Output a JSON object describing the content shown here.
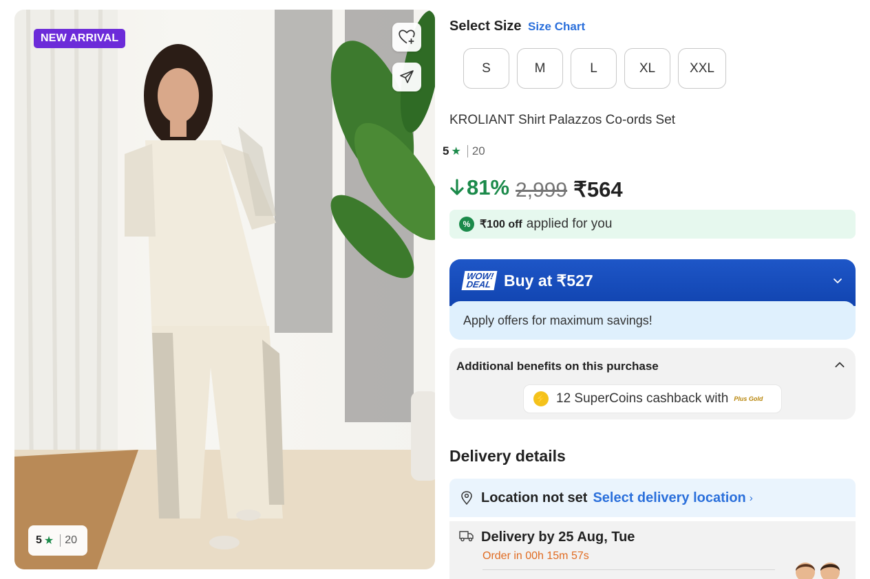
{
  "product": {
    "badge": "NEW ARRIVAL",
    "image_rating": {
      "value": "5",
      "count": "20"
    },
    "title": "KROLIANT Shirt Palazzos Co-ords Set",
    "rating": {
      "value": "5",
      "count": "20"
    }
  },
  "size": {
    "heading": "Select Size",
    "chart_link": "Size Chart",
    "options": [
      "S",
      "M",
      "L",
      "XL",
      "XXL"
    ]
  },
  "price": {
    "discount": "81%",
    "mrp": "2,999",
    "final": "₹564"
  },
  "offer_applied": {
    "amount": "₹100 off",
    "text": "applied for you"
  },
  "wow_deal": {
    "logo_line1": "WOW!",
    "logo_line2": "DEAL",
    "title": "Buy at ₹527",
    "subtitle": "Apply offers for maximum savings!"
  },
  "benefits": {
    "heading": "Additional benefits on this purchase",
    "coins_text": "12 SuperCoins cashback with",
    "coins_badge": "Plus Gold"
  },
  "delivery": {
    "heading": "Delivery details",
    "location_label": "Location not set",
    "location_link": "Select delivery location",
    "date": "Delivery by 25 Aug, Tue",
    "timer": "Order in 00h 15m 57s"
  },
  "colors": {
    "accent_blue": "#2a6fdb",
    "discount_green": "#1b8a4a",
    "badge_purple": "#6c2bd9",
    "wow_blue": "#1144b0",
    "timer_orange": "#e06b21"
  },
  "icons": [
    "wishlist-add-icon",
    "share-icon",
    "star-icon",
    "percent-icon",
    "chevron-down-icon",
    "chevron-up-icon",
    "supercoin-icon",
    "location-pin-icon",
    "chevron-right-icon",
    "delivery-truck-icon",
    "arrow-down-icon"
  ]
}
